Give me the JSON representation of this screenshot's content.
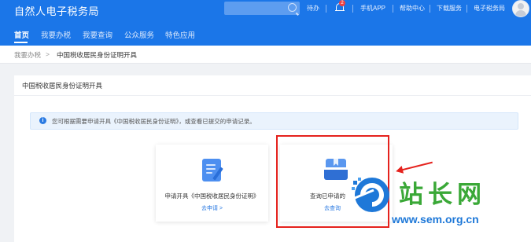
{
  "header": {
    "brand": "自然人电子税务局",
    "links": [
      "待办",
      "手机APP",
      "帮助中心",
      "下载服务",
      "电子税务局"
    ],
    "bell_badge": "2"
  },
  "nav": [
    "首页",
    "我要办税",
    "我要查询",
    "公众服务",
    "特色应用"
  ],
  "breadcrumb": {
    "parent": "我要办税",
    "sep": ">",
    "current": "中国税收居民身份证明开具"
  },
  "card": {
    "title": "中国税收居民身份证明开具",
    "notice": "您可根据需要申请开具《中国税收居民身份证明》，或查看已提交的申请记录。",
    "apply": {
      "label": "申请开具《中国税收居民身份证明》",
      "link": "去申请 >"
    },
    "query": {
      "label": "查询已申请的",
      "link": "去查询"
    }
  },
  "watermark": {
    "title": "站长网",
    "url": "www.sem.org.cn"
  },
  "colors": {
    "primary": "#1b76e8",
    "highlight": "#e5221d"
  }
}
